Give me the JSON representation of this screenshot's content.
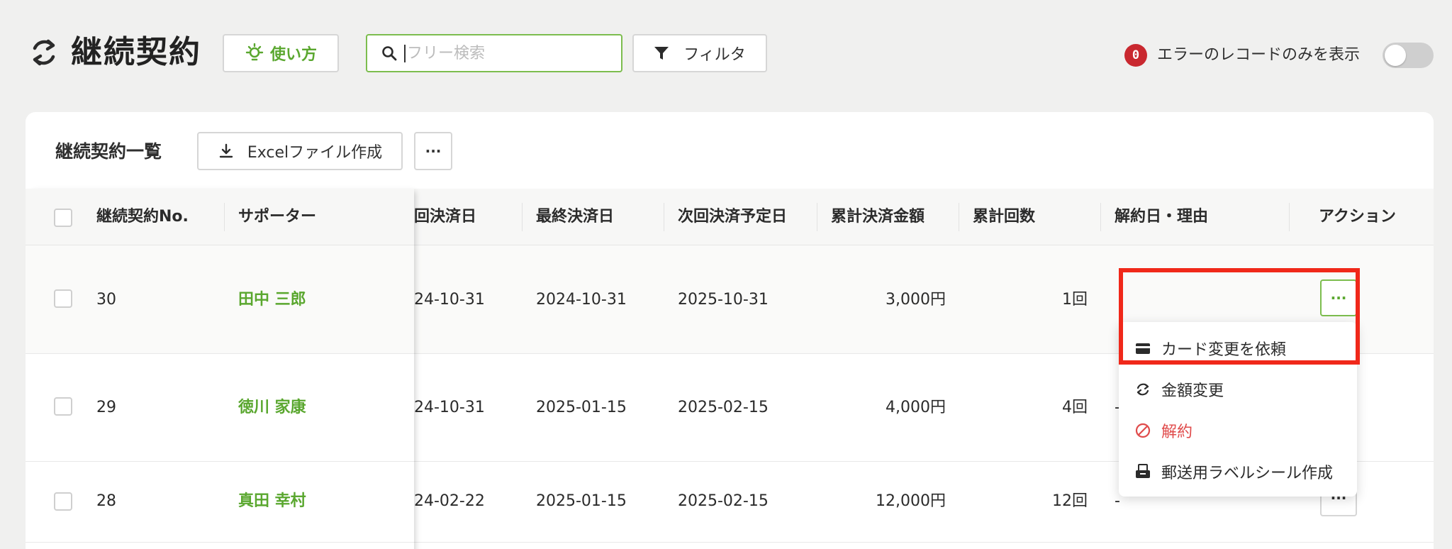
{
  "header": {
    "title": "継続契約",
    "help_label": "使い方",
    "search_placeholder": "フリー検索",
    "filter_label": "フィルタ",
    "error_count": "0",
    "error_toggle_label": "エラーのレコードのみを表示"
  },
  "card": {
    "title": "継続契約一覧",
    "excel_label": "Excelファイル作成",
    "more_label": "···"
  },
  "table": {
    "columns": [
      "継続契約No.",
      "サポーター",
      "回決済日",
      "最終決済日",
      "次回決済予定日",
      "累計決済金額",
      "累計回数",
      "解約日・理由",
      "アクション"
    ],
    "rows": [
      {
        "no": "30",
        "supporter": "田中 三郎",
        "first_date": "24-10-31",
        "last_date": "2024-10-31",
        "next_date": "2025-10-31",
        "amount": "3,000円",
        "count": "1回",
        "cancel": "",
        "action": "···"
      },
      {
        "no": "29",
        "supporter": "徳川 家康",
        "first_date": "24-10-31",
        "last_date": "2025-01-15",
        "next_date": "2025-02-15",
        "amount": "4,000円",
        "count": "4回",
        "cancel": "-",
        "action": "···"
      },
      {
        "no": "28",
        "supporter": "真田 幸村",
        "first_date": "24-02-22",
        "last_date": "2025-01-15",
        "next_date": "2025-02-15",
        "amount": "12,000円",
        "count": "12回",
        "cancel": "-",
        "action": "···"
      }
    ]
  },
  "menu": {
    "items": [
      {
        "label": "カード変更を依頼",
        "icon": "credit-card-icon"
      },
      {
        "label": "金額変更",
        "icon": "refresh-icon"
      },
      {
        "label": "解約",
        "icon": "prohibited-icon"
      },
      {
        "label": "郵送用ラベルシール作成",
        "icon": "label-printer-icon"
      }
    ]
  },
  "colors": {
    "accent_green": "#5aa72f",
    "danger_red": "#e04b4b",
    "highlight_red": "#f0281a",
    "badge_red": "#c9282f"
  }
}
